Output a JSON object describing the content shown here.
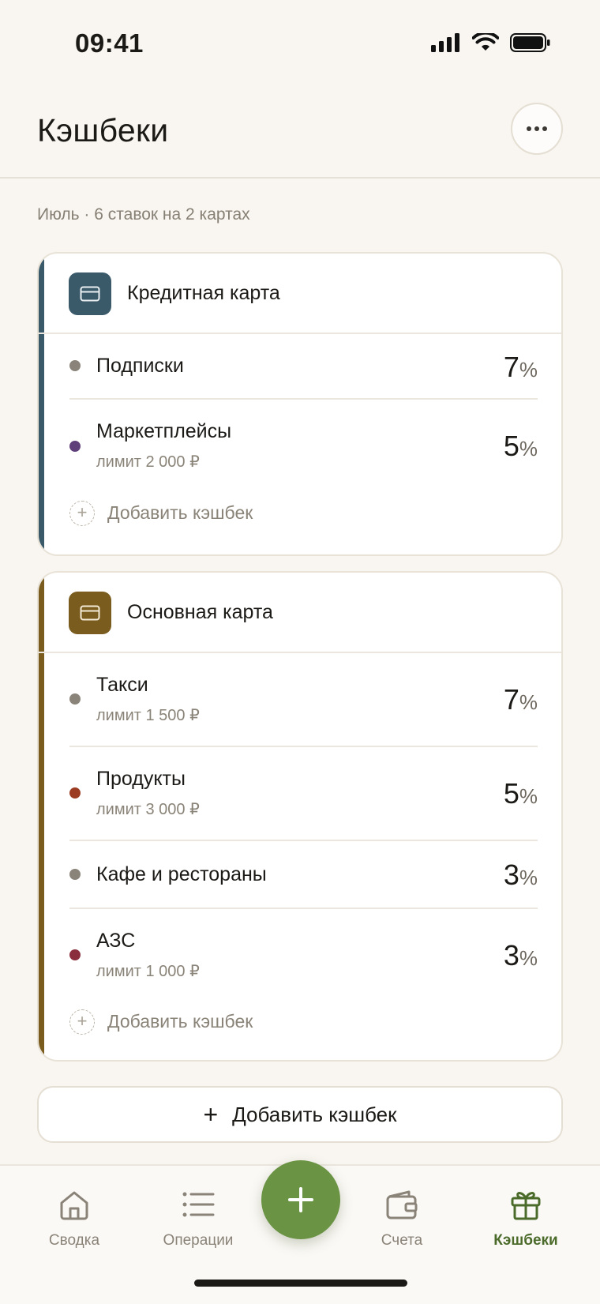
{
  "status_bar": {
    "time": "09:41"
  },
  "header": {
    "title": "Кэшбеки",
    "more_icon": "ellipsis-icon"
  },
  "summary": "Июль · 6 ставок на 2 картах",
  "cards": [
    {
      "name": "Кредитная карта",
      "accent": "#3a5a6a",
      "items": [
        {
          "category": "Подписки",
          "limit": "",
          "rate": "7",
          "dot": "#8a8379"
        },
        {
          "category": "Маркетплейсы",
          "limit": "лимит 2 000 ₽",
          "rate": "5",
          "dot": "#5f3f7a"
        }
      ],
      "add_label": "Добавить кэшбек"
    },
    {
      "name": "Основная карта",
      "accent": "#7a5c1e",
      "items": [
        {
          "category": "Такси",
          "limit": "лимит 1 500 ₽",
          "rate": "7",
          "dot": "#8a8379"
        },
        {
          "category": "Продукты",
          "limit": "лимит 3 000 ₽",
          "rate": "5",
          "dot": "#9b3c22"
        },
        {
          "category": "Кафе и рестораны",
          "limit": "",
          "rate": "3",
          "dot": "#8a8379"
        },
        {
          "category": "АЗС",
          "limit": "лимит 1 000 ₽",
          "rate": "3",
          "dot": "#8a2e3e"
        }
      ],
      "add_label": "Добавить кэшбек"
    }
  ],
  "percent_sign": "%",
  "add_button": {
    "label": "Добавить кэшбек"
  },
  "tabs": [
    {
      "label": "Сводка",
      "icon": "home-icon"
    },
    {
      "label": "Операции",
      "icon": "list-icon"
    },
    {
      "label": "Счета",
      "icon": "wallet-icon"
    },
    {
      "label": "Кэшбеки",
      "icon": "gift-icon",
      "active": true
    }
  ],
  "colors": {
    "accent_green": "#6b9344",
    "active_tab": "#4b6b2a"
  }
}
